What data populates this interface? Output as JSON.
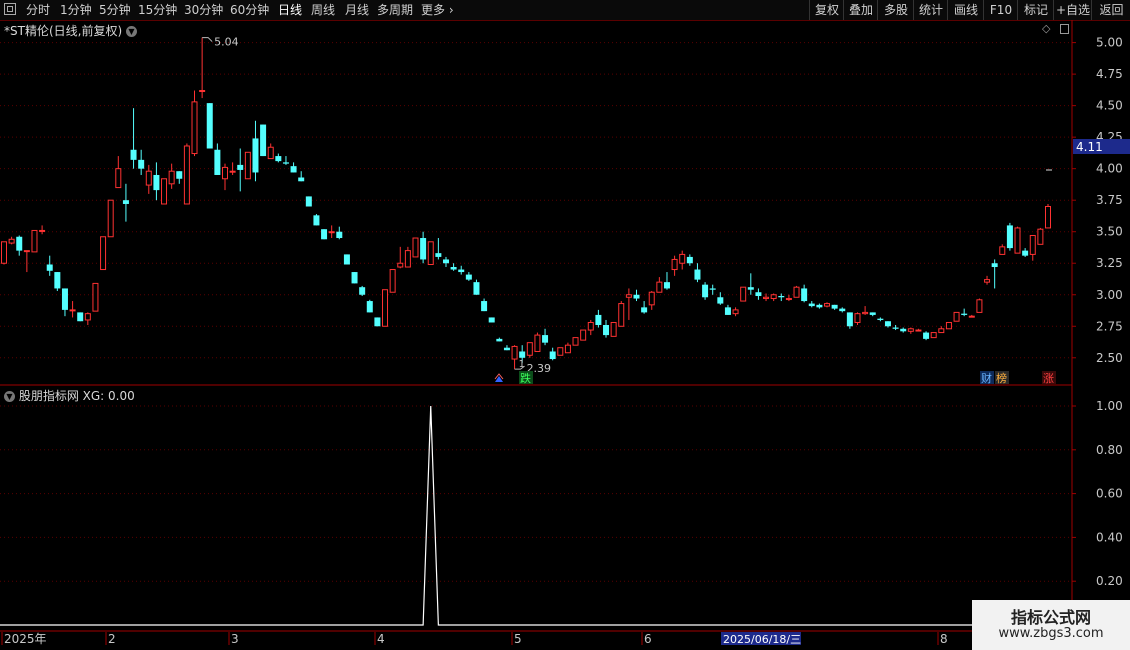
{
  "toolbar": {
    "left_items": [
      "分时",
      "1分钟",
      "5分钟",
      "15分钟",
      "30分钟",
      "60分钟",
      "日线",
      "周线",
      "月线",
      "多周期",
      "更多"
    ],
    "active_item": "日线",
    "right_items": [
      "复权",
      "叠加",
      "多股",
      "统计",
      "画线",
      "F10",
      "标记",
      "+自选",
      "返回"
    ]
  },
  "main_chart": {
    "title": "*ST精伦(日线,前复权)",
    "high_label": "5.04",
    "low_label": "2.39",
    "marker_low": "1",
    "current_price": "4.11",
    "badge_die": "跌",
    "badge_cai": "财",
    "badge_bang": "榜",
    "badge_zhang": "涨",
    "y_ticks": [
      "5.00",
      "4.75",
      "4.50",
      "4.25",
      "4.00",
      "3.75",
      "3.50",
      "3.25",
      "3.00",
      "2.75",
      "2.50"
    ],
    "colors": {
      "up": "#ff3232",
      "down": "#54ffff",
      "axis": "#a00000",
      "grid": "#5a0000"
    }
  },
  "sub_chart": {
    "title": "股朋指标网 XG: 0.00",
    "y_ticks": [
      "1.00",
      "0.80",
      "0.60",
      "0.40",
      "0.20"
    ]
  },
  "x_axis": {
    "labels": [
      "2025年",
      "2",
      "3",
      "4",
      "5",
      "6",
      "8"
    ],
    "cursor_date": "2025/06/18/三"
  },
  "watermark": {
    "line1": "指标公式网",
    "line2": "www.zbgs3.com"
  },
  "chart_data": {
    "type": "candlestick",
    "ylim": [
      2.3,
      5.1
    ],
    "candles": [
      [
        3.25,
        3.42,
        3.24,
        3.42
      ],
      [
        3.41,
        3.46,
        3.4,
        3.44
      ],
      [
        3.46,
        3.47,
        3.31,
        3.35
      ],
      [
        3.35,
        3.35,
        3.18,
        3.35
      ],
      [
        3.34,
        3.51,
        3.34,
        3.51
      ],
      [
        3.51,
        3.55,
        3.48,
        3.51
      ],
      [
        3.24,
        3.31,
        3.15,
        3.19
      ],
      [
        3.18,
        3.18,
        3.03,
        3.05
      ],
      [
        3.05,
        3.05,
        2.83,
        2.88
      ],
      [
        2.88,
        2.95,
        2.82,
        2.88
      ],
      [
        2.86,
        2.86,
        2.79,
        2.79
      ],
      [
        2.8,
        2.86,
        2.76,
        2.85
      ],
      [
        2.87,
        3.09,
        2.87,
        3.09
      ],
      [
        3.2,
        3.46,
        3.2,
        3.46
      ],
      [
        3.46,
        3.75,
        3.46,
        3.75
      ],
      [
        3.85,
        4.1,
        3.85,
        4.0
      ],
      [
        3.75,
        3.88,
        3.58,
        3.72
      ],
      [
        4.15,
        4.48,
        4.0,
        4.07
      ],
      [
        4.07,
        4.15,
        3.95,
        4.0
      ],
      [
        3.87,
        4.03,
        3.8,
        3.98
      ],
      [
        3.95,
        4.05,
        3.75,
        3.83
      ],
      [
        3.72,
        3.92,
        3.72,
        3.92
      ],
      [
        3.88,
        4.04,
        3.84,
        3.98
      ],
      [
        3.98,
        3.98,
        3.88,
        3.92
      ],
      [
        3.72,
        4.2,
        3.72,
        4.18
      ],
      [
        4.12,
        4.62,
        4.1,
        4.53
      ],
      [
        4.62,
        5.04,
        4.56,
        4.62
      ],
      [
        4.52,
        4.52,
        4.2,
        4.16
      ],
      [
        4.15,
        4.2,
        3.95,
        3.95
      ],
      [
        3.92,
        4.04,
        3.83,
        4.01
      ],
      [
        3.98,
        4.05,
        3.95,
        3.98
      ],
      [
        4.03,
        4.16,
        3.82,
        3.99
      ],
      [
        3.92,
        4.13,
        3.92,
        4.13
      ],
      [
        4.24,
        4.38,
        3.9,
        3.97
      ],
      [
        4.35,
        4.35,
        4.1,
        4.1
      ],
      [
        4.08,
        4.2,
        4.08,
        4.17
      ],
      [
        4.1,
        4.12,
        4.05,
        4.06
      ],
      [
        4.05,
        4.1,
        4.03,
        4.04
      ],
      [
        4.02,
        4.05,
        3.97,
        3.97
      ],
      [
        3.93,
        3.98,
        3.9,
        3.9
      ],
      [
        3.78,
        3.78,
        3.7,
        3.7
      ],
      [
        3.63,
        3.64,
        3.55,
        3.55
      ],
      [
        3.52,
        3.52,
        3.44,
        3.44
      ],
      [
        3.5,
        3.55,
        3.45,
        3.5
      ],
      [
        3.5,
        3.54,
        3.44,
        3.45
      ],
      [
        3.32,
        3.32,
        3.24,
        3.24
      ],
      [
        3.18,
        3.18,
        3.09,
        3.09
      ],
      [
        3.06,
        3.07,
        2.99,
        3.0
      ],
      [
        2.95,
        2.96,
        2.86,
        2.86
      ],
      [
        2.82,
        2.82,
        2.75,
        2.75
      ],
      [
        2.75,
        3.04,
        2.75,
        3.04
      ],
      [
        3.02,
        3.2,
        3.02,
        3.2
      ],
      [
        3.22,
        3.38,
        3.21,
        3.25
      ],
      [
        3.22,
        3.38,
        3.22,
        3.35
      ],
      [
        3.3,
        3.45,
        3.3,
        3.45
      ],
      [
        3.45,
        3.5,
        3.25,
        3.28
      ],
      [
        3.24,
        3.42,
        3.24,
        3.42
      ],
      [
        3.33,
        3.45,
        3.28,
        3.3
      ],
      [
        3.28,
        3.3,
        3.22,
        3.25
      ],
      [
        3.22,
        3.25,
        3.19,
        3.2
      ],
      [
        3.2,
        3.23,
        3.16,
        3.18
      ],
      [
        3.16,
        3.18,
        3.11,
        3.12
      ],
      [
        3.1,
        3.12,
        3.0,
        3.0
      ],
      [
        2.95,
        2.97,
        2.87,
        2.87
      ],
      [
        2.82,
        2.82,
        2.78,
        2.78
      ],
      [
        2.65,
        2.66,
        2.63,
        2.63
      ],
      [
        2.58,
        2.6,
        2.56,
        2.56
      ],
      [
        2.49,
        2.6,
        2.41,
        2.59
      ],
      [
        2.55,
        2.6,
        2.46,
        2.5
      ],
      [
        2.52,
        2.62,
        2.5,
        2.62
      ],
      [
        2.55,
        2.7,
        2.55,
        2.68
      ],
      [
        2.68,
        2.73,
        2.6,
        2.62
      ],
      [
        2.55,
        2.58,
        2.48,
        2.49
      ],
      [
        2.52,
        2.58,
        2.52,
        2.58
      ],
      [
        2.54,
        2.62,
        2.54,
        2.6
      ],
      [
        2.6,
        2.66,
        2.6,
        2.66
      ],
      [
        2.64,
        2.72,
        2.64,
        2.72
      ],
      [
        2.72,
        2.8,
        2.68,
        2.78
      ],
      [
        2.84,
        2.88,
        2.74,
        2.76
      ],
      [
        2.76,
        2.8,
        2.66,
        2.68
      ],
      [
        2.67,
        2.78,
        2.67,
        2.78
      ],
      [
        2.75,
        2.95,
        2.75,
        2.93
      ],
      [
        2.98,
        3.05,
        2.8,
        3.0
      ],
      [
        3.0,
        3.04,
        2.95,
        2.97
      ],
      [
        2.9,
        2.95,
        2.85,
        2.86
      ],
      [
        2.92,
        3.03,
        2.88,
        3.02
      ],
      [
        3.02,
        3.14,
        3.02,
        3.1
      ],
      [
        3.1,
        3.18,
        3.04,
        3.05
      ],
      [
        3.2,
        3.31,
        3.15,
        3.28
      ],
      [
        3.25,
        3.35,
        3.2,
        3.32
      ],
      [
        3.3,
        3.32,
        3.23,
        3.25
      ],
      [
        3.2,
        3.25,
        3.1,
        3.12
      ],
      [
        3.08,
        3.1,
        2.96,
        2.98
      ],
      [
        3.05,
        3.08,
        3.0,
        3.04
      ],
      [
        2.98,
        3.02,
        2.92,
        2.93
      ],
      [
        2.9,
        2.92,
        2.84,
        2.84
      ],
      [
        2.85,
        2.9,
        2.83,
        2.88
      ],
      [
        2.95,
        3.06,
        2.95,
        3.06
      ],
      [
        3.06,
        3.17,
        3.0,
        3.04
      ],
      [
        3.02,
        3.05,
        2.96,
        2.99
      ],
      [
        2.97,
        3.01,
        2.95,
        2.98
      ],
      [
        2.97,
        3.01,
        2.95,
        3.0
      ],
      [
        2.99,
        3.01,
        2.95,
        2.98
      ],
      [
        2.97,
        3.0,
        2.95,
        2.97
      ],
      [
        2.98,
        3.07,
        2.98,
        3.06
      ],
      [
        3.05,
        3.08,
        2.94,
        2.95
      ],
      [
        2.93,
        2.95,
        2.9,
        2.91
      ],
      [
        2.92,
        2.93,
        2.89,
        2.9
      ],
      [
        2.91,
        2.94,
        2.9,
        2.93
      ],
      [
        2.92,
        2.92,
        2.88,
        2.89
      ],
      [
        2.89,
        2.9,
        2.86,
        2.87
      ],
      [
        2.86,
        2.86,
        2.73,
        2.75
      ],
      [
        2.78,
        2.86,
        2.76,
        2.85
      ],
      [
        2.85,
        2.91,
        2.84,
        2.86
      ],
      [
        2.86,
        2.86,
        2.83,
        2.84
      ],
      [
        2.81,
        2.82,
        2.79,
        2.8
      ],
      [
        2.79,
        2.79,
        2.74,
        2.75
      ],
      [
        2.74,
        2.76,
        2.72,
        2.73
      ],
      [
        2.73,
        2.74,
        2.7,
        2.71
      ],
      [
        2.71,
        2.74,
        2.69,
        2.73
      ],
      [
        2.72,
        2.73,
        2.71,
        2.72
      ],
      [
        2.7,
        2.71,
        2.64,
        2.65
      ],
      [
        2.66,
        2.7,
        2.66,
        2.7
      ],
      [
        2.7,
        2.75,
        2.7,
        2.73
      ],
      [
        2.73,
        2.78,
        2.73,
        2.78
      ],
      [
        2.79,
        2.86,
        2.79,
        2.86
      ],
      [
        2.85,
        2.89,
        2.83,
        2.84
      ],
      [
        2.83,
        2.84,
        2.82,
        2.83
      ],
      [
        2.86,
        2.97,
        2.86,
        2.96
      ],
      [
        3.1,
        3.15,
        3.08,
        3.12
      ],
      [
        3.25,
        3.28,
        3.05,
        3.22
      ],
      [
        3.32,
        3.4,
        3.32,
        3.38
      ],
      [
        3.55,
        3.57,
        3.35,
        3.37
      ],
      [
        3.33,
        3.54,
        3.33,
        3.53
      ],
      [
        3.35,
        3.37,
        3.3,
        3.31
      ],
      [
        3.32,
        3.47,
        3.27,
        3.47
      ],
      [
        3.4,
        3.53,
        3.4,
        3.52
      ],
      [
        3.53,
        3.72,
        3.53,
        3.7
      ]
    ],
    "indicator": {
      "name": "XG",
      "value": "0.00",
      "ylim": [
        0,
        1.0
      ],
      "spike_index": 56,
      "spike_value": 1.0
    }
  }
}
